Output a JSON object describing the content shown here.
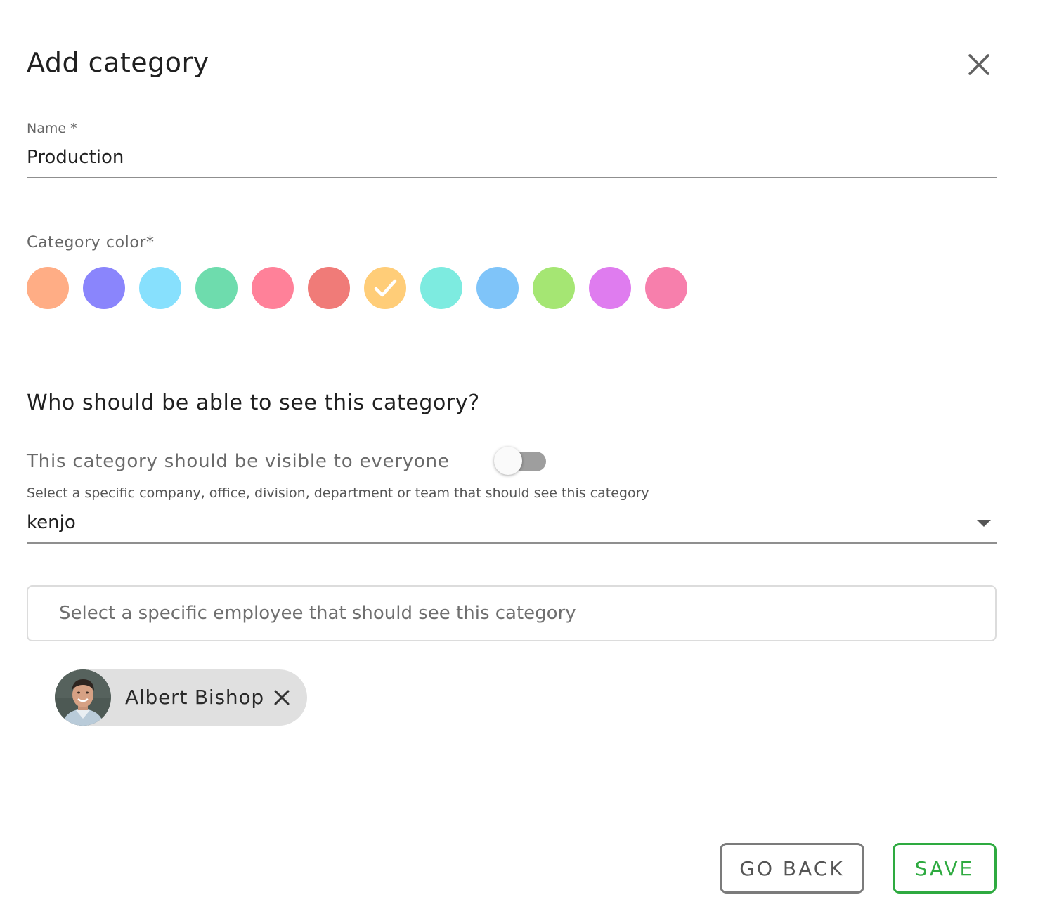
{
  "dialog": {
    "title": "Add category"
  },
  "name_field": {
    "label": "Name *",
    "value": "Production"
  },
  "category_color": {
    "label": "Category color*",
    "selected_index": 6,
    "options": [
      {
        "color": "#ffad85"
      },
      {
        "color": "#8a85fc"
      },
      {
        "color": "#87e0fd"
      },
      {
        "color": "#6edcad"
      },
      {
        "color": "#ff8199"
      },
      {
        "color": "#f07b78"
      },
      {
        "color": "#ffcd78"
      },
      {
        "color": "#7debe0"
      },
      {
        "color": "#7fc4f9"
      },
      {
        "color": "#a5e673"
      },
      {
        "color": "#df7cef"
      },
      {
        "color": "#f77fac"
      }
    ]
  },
  "visibility": {
    "heading": "Who should be able to see this category?",
    "everyone_label": "This category should be visible to everyone",
    "everyone_enabled": false,
    "scope_label": "Select a specific company, office, division, department or team that should see this category",
    "scope_value": "kenjo",
    "employee_placeholder": "Select a specific employee that should see this category",
    "selected_employees": [
      {
        "name": "Albert Bishop"
      }
    ]
  },
  "actions": {
    "back_label": "GO BACK",
    "save_label": "SAVE"
  },
  "colors": {
    "accent_green": "#2eaa40",
    "outline_gray": "#7b7b7b"
  }
}
